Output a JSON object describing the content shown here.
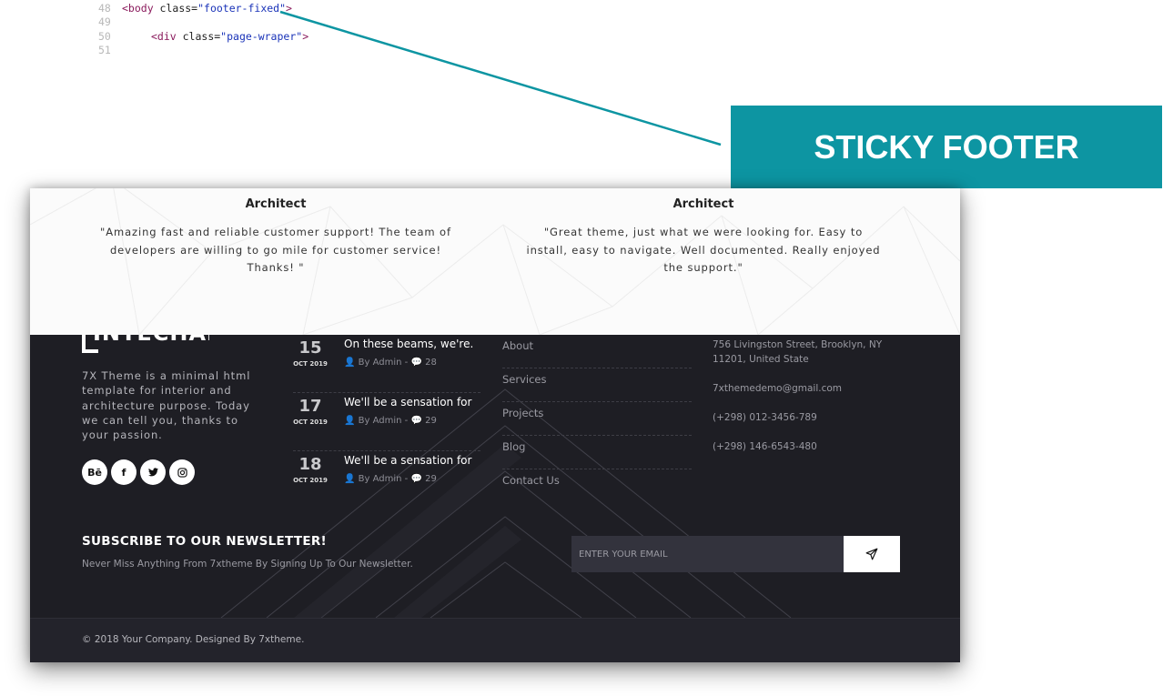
{
  "code": {
    "lines": [
      {
        "num": "48",
        "tag_open": "<body",
        "attr": " class=",
        "value": "\"footer-fixed\"",
        "tag_close": ">"
      },
      {
        "num": "49"
      },
      {
        "num": "50",
        "tag_open": "<div",
        "attr": " class=",
        "value": "\"page-wraper\"",
        "tag_close": ">"
      },
      {
        "num": "51"
      }
    ]
  },
  "callout": {
    "label": "STICKY FOOTER",
    "color": "#0d95a2"
  },
  "testimonials": [
    {
      "role": "Architect",
      "quote": "\"Amazing fast and reliable customer support! The team of developers are willing to go mile for customer service! Thanks! \""
    },
    {
      "role": "Architect",
      "quote": "\"Great theme, just what we were looking for. Easy to install, easy to navigate. Well documented. Really enjoyed the support.\""
    }
  ],
  "footer": {
    "logo_text": "INTECHAPE",
    "about": "7X Theme is a minimal html template for interior and architecture purpose. Today we can tell you, thanks to your passion.",
    "social": [
      {
        "icon": "behance-icon",
        "glyph": "Bē"
      },
      {
        "icon": "facebook-icon",
        "glyph": "f"
      },
      {
        "icon": "twitter-icon",
        "glyph": "t"
      },
      {
        "icon": "instagram-icon",
        "glyph": "◎"
      }
    ],
    "posts": [
      {
        "day": "15",
        "month": "OCT 2019",
        "title": "On these beams, we're.",
        "author": "By Admin",
        "comments": "28"
      },
      {
        "day": "17",
        "month": "OCT 2019",
        "title": "We'll be a sensation for",
        "author": "By Admin",
        "comments": "29"
      },
      {
        "day": "18",
        "month": "OCT 2019",
        "title": "We'll be a sensation for",
        "author": "By Admin",
        "comments": "29"
      }
    ],
    "links": [
      "About",
      "Services",
      "Projects",
      "Blog",
      "Contact Us"
    ],
    "contact": {
      "address": "756 Livingston Street, Brooklyn, NY 11201, United State",
      "email": "7xthemedemo@gmail.com",
      "phone1": "(+298) 012-3456-789",
      "phone2": "(+298) 146-6543-480"
    },
    "newsletter": {
      "title": "SUBSCRIBE TO OUR NEWSLETTER!",
      "subtitle": "Never Miss Anything From 7xtheme By Signing Up To Our Newsletter.",
      "placeholder": "ENTER YOUR EMAIL",
      "send_icon": "paper-plane-icon"
    },
    "copyright": "© 2018 Your Company. Designed By 7xtheme."
  }
}
